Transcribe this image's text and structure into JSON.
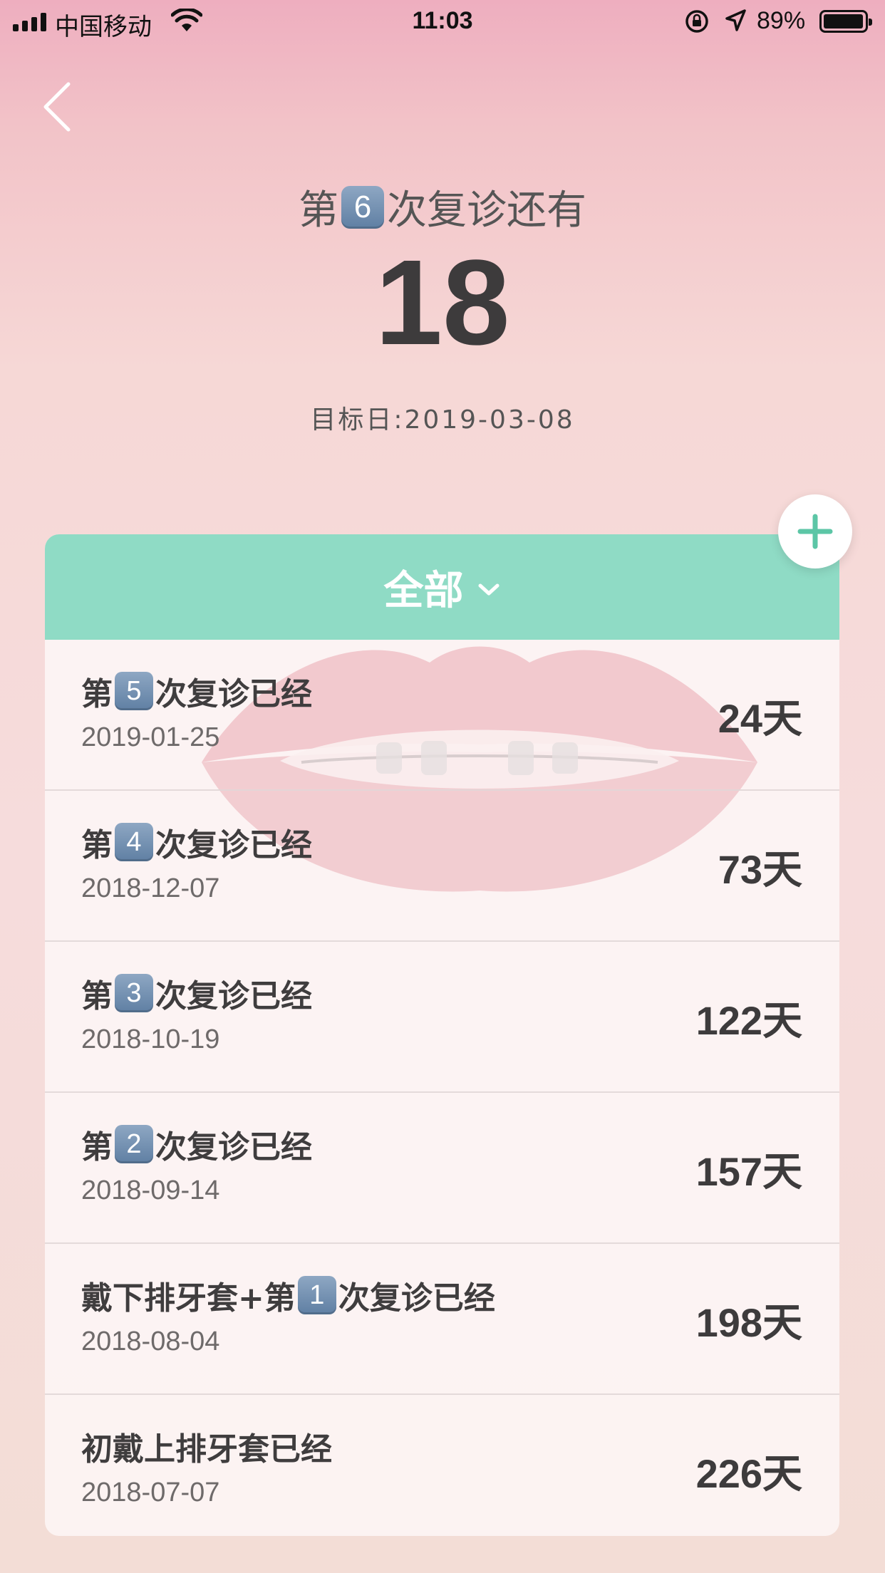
{
  "status_bar": {
    "carrier": "中国移动",
    "time": "11:03",
    "battery_percent": "89%",
    "battery_level": 0.89
  },
  "header": {
    "prefix": "第",
    "number_badge": "6",
    "suffix": "次复诊还有",
    "days_remaining": "18",
    "target_date_label": "目标日:2019-03-08"
  },
  "filter": {
    "label": "全部"
  },
  "colors": {
    "accent_green": "#8fdbc5",
    "badge_blue": "#6c8aad"
  },
  "icons": [
    "back-chevron-icon",
    "plus-icon",
    "chevron-down-icon",
    "wifi-icon",
    "location-icon",
    "rotation-lock-icon"
  ],
  "items": [
    {
      "prefix": "第",
      "badge": "5",
      "suffix": "次复诊已经",
      "date": "2019-01-25",
      "days": "24",
      "unit": "天"
    },
    {
      "prefix": "第",
      "badge": "4",
      "suffix": "次复诊已经",
      "date": "2018-12-07",
      "days": "73",
      "unit": "天"
    },
    {
      "prefix": "第",
      "badge": "3",
      "suffix": "次复诊已经",
      "date": "2018-10-19",
      "days": "122",
      "unit": "天"
    },
    {
      "prefix": "第",
      "badge": "2",
      "suffix": "次复诊已经",
      "date": "2018-09-14",
      "days": "157",
      "unit": "天"
    },
    {
      "prefix": "戴下排牙套+第",
      "badge": "1",
      "suffix": "次复诊已经",
      "date": "2018-08-04",
      "days": "198",
      "unit": "天"
    },
    {
      "prefix": "初戴上排牙套已经",
      "badge": "",
      "suffix": "",
      "date": "2018-07-07",
      "days": "226",
      "unit": "天"
    }
  ]
}
